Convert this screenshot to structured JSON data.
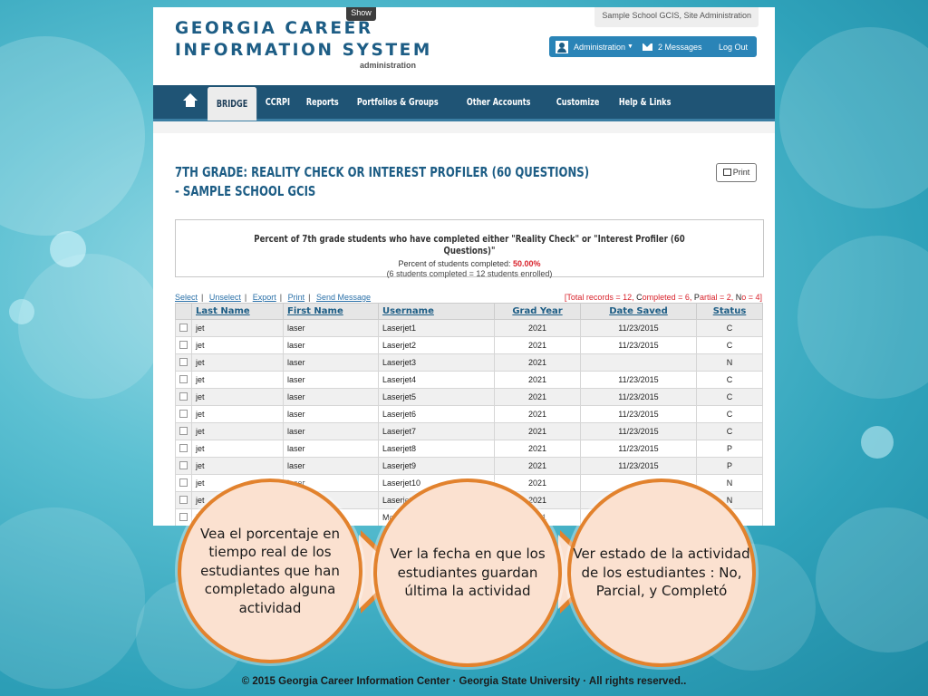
{
  "header": {
    "show_tab": "Show",
    "school_tag": "Sample School GCIS, Site Administration",
    "logo_line1": "GEORGIA CAREER",
    "logo_line2": "INFORMATION SYSTEM",
    "logo_sub": "administration",
    "admin_label": "Administration",
    "messages_label": "2 Messages",
    "logout_label": "Log Out"
  },
  "nav": {
    "items": [
      "BRIDGE",
      "CCRPI",
      "Reports",
      "Portfolios & Groups",
      "Other Accounts",
      "Customize",
      "Help & Links"
    ],
    "active": "BRIDGE"
  },
  "page": {
    "title_line1": "7TH GRADE: REALITY CHECK OR INTEREST PROFILER (60 QUESTIONS)",
    "title_line2": "- SAMPLE SCHOOL GCIS",
    "print_label": "Print"
  },
  "stats": {
    "heading": "Percent of 7th grade students who have completed either \"Reality Check\" or \"Interest Profiler (60 Questions)\"",
    "pct_label": "Percent of students completed:",
    "pct_value": "50.00%",
    "note": "(6 students completed = 12 students enrolled)"
  },
  "actions": [
    "Select",
    "Unselect",
    "Export",
    "Print",
    "Send Message"
  ],
  "totals": {
    "prefix": "[Total records = 12, ",
    "c_letter": "C",
    "c_text": "ompleted = 6, ",
    "p_letter": "P",
    "p_text": "artial = 2, ",
    "n_letter": "N",
    "n_text": "o = 4]"
  },
  "table": {
    "columns": [
      "Last Name",
      "First Name",
      "Username",
      "Grad Year",
      "Date Saved",
      "Status"
    ],
    "rows": [
      [
        "jet",
        "laser",
        "Laserjet1",
        "2021",
        "11/23/2015",
        "C"
      ],
      [
        "jet",
        "laser",
        "Laserjet2",
        "2021",
        "11/23/2015",
        "C"
      ],
      [
        "jet",
        "laser",
        "Laserjet3",
        "2021",
        "",
        "N"
      ],
      [
        "jet",
        "laser",
        "Laserjet4",
        "2021",
        "11/23/2015",
        "C"
      ],
      [
        "jet",
        "laser",
        "Laserjet5",
        "2021",
        "11/23/2015",
        "C"
      ],
      [
        "jet",
        "laser",
        "Laserjet6",
        "2021",
        "11/23/2015",
        "C"
      ],
      [
        "jet",
        "laser",
        "Laserjet7",
        "2021",
        "11/23/2015",
        "C"
      ],
      [
        "jet",
        "laser",
        "Laserjet8",
        "2021",
        "11/23/2015",
        "P"
      ],
      [
        "jet",
        "laser",
        "Laserjet9",
        "2021",
        "11/23/2015",
        "P"
      ],
      [
        "jet",
        "laser",
        "Laserjet10",
        "2021",
        "",
        "N"
      ],
      [
        "jet",
        "laser",
        "Laserjet11",
        "2021",
        "",
        "N"
      ],
      [
        "Mo",
        "",
        "Mon",
        "2021",
        "",
        ""
      ]
    ]
  },
  "callouts": [
    "Vea el porcentaje en tiempo real de los estudiantes que han completado alguna actividad",
    "Ver la fecha en que los estudiantes guardan última la actividad",
    "Ver estado de la actividad de los estudiantes : No, Parcial, y Completó"
  ],
  "footer": "© 2015 Georgia Career Information Center · Georgia State University · All rights reserved..",
  "colors": {
    "brand_blue": "#1d5d85",
    "nav_bg": "#1f5475",
    "accent_red": "#d9232c",
    "bubble_border": "#e2822d",
    "bubble_fill": "#fbe1d0"
  }
}
